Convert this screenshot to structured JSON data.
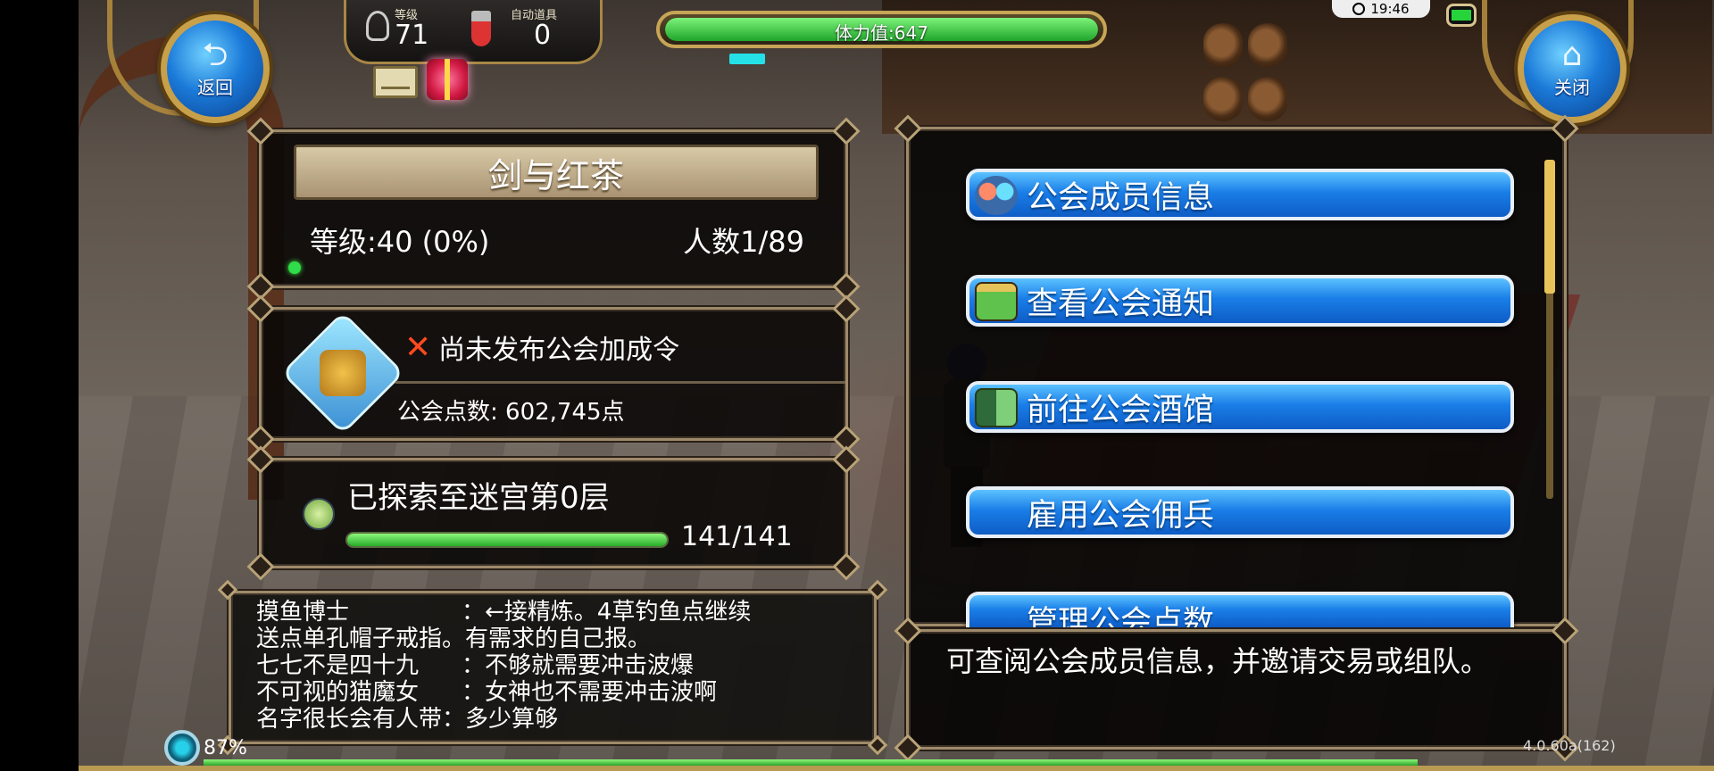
{
  "hud": {
    "back_label": "返回",
    "close_label": "关闭",
    "level_caption": "等级",
    "level_value": "71",
    "auto_item_caption": "自动道具",
    "auto_item_value": "0",
    "stamina_label": "体力值:647",
    "stamina_fraction": 1.0,
    "clock": "19:46"
  },
  "guild": {
    "name": "剑与红茶",
    "level_text": "等级:40 (0%)",
    "members_text": "人数1/89"
  },
  "bonus": {
    "status_text": "尚未发布公会加成令",
    "points_text": "公会点数: 602,745点"
  },
  "dungeon": {
    "title": "已探索至迷宫第0层",
    "progress_text": "141/141",
    "progress_fraction": 1.0
  },
  "chat": [
    {
      "name": "摸鱼博士",
      "sep": "：",
      "text": "←接精炼。4草钓鱼点继续"
    },
    {
      "name": "送点单孔帽子戒指。有需求的自己报。",
      "sep": "",
      "text": ""
    },
    {
      "name": "七七不是四十九",
      "sep": "：",
      "text": "不够就需要冲击波爆"
    },
    {
      "name": "不可视的猫魔女",
      "sep": "：",
      "text": "女神也不需要冲击波啊"
    },
    {
      "name": "名字很长会有人带",
      "sep": "：",
      "text": "多少算够"
    }
  ],
  "menu": {
    "members": "公会成员信息",
    "notice": "查看公会通知",
    "tavern": "前往公会酒馆",
    "mercenary": "雇用公会佣兵",
    "points": "管理公会点数"
  },
  "description": "可查阅公会成员信息，并邀请交易或组队。",
  "footer": {
    "network_percent": "87%",
    "version": "4.0.60a(162)"
  }
}
